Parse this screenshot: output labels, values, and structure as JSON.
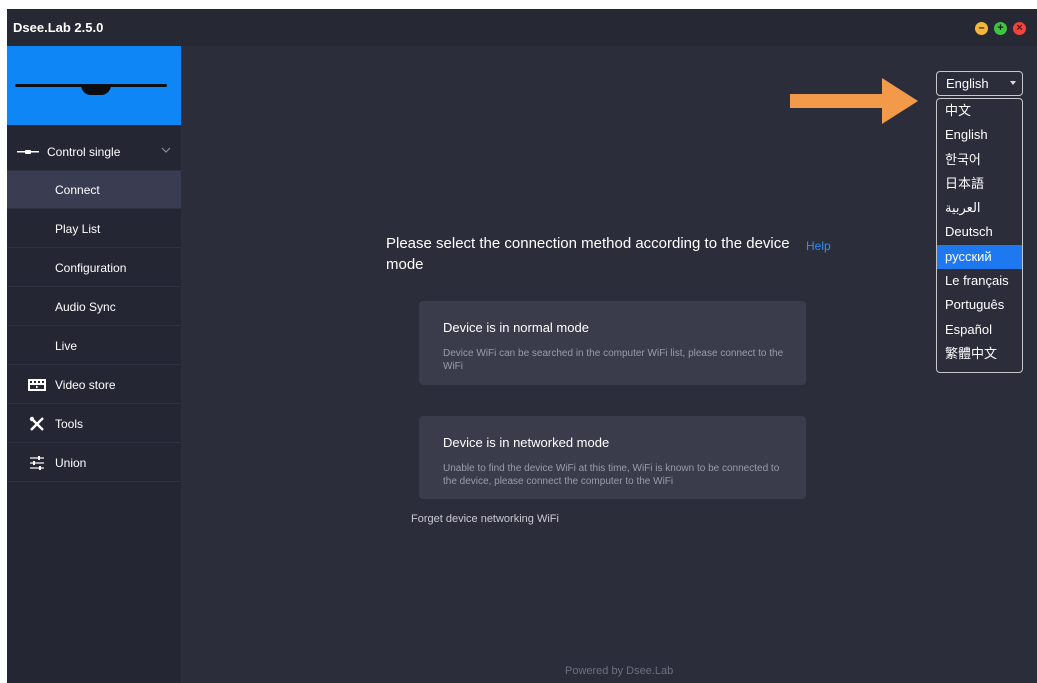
{
  "app": {
    "title": "Dsee.Lab 2.5.0"
  },
  "colors": {
    "accent": "#1e78f0",
    "link": "#2f8ef5",
    "arrow": "#f29a4a",
    "banner": "#0f86f5"
  },
  "sidebar": {
    "group": {
      "label": "Control single",
      "icon": "drone-icon"
    },
    "items": [
      {
        "label": "Connect",
        "active": true
      },
      {
        "label": "Play List"
      },
      {
        "label": "Configuration"
      },
      {
        "label": "Audio Sync"
      },
      {
        "label": "Live"
      }
    ],
    "sections": [
      {
        "label": "Video store",
        "icon": "film-icon"
      },
      {
        "label": "Tools",
        "icon": "tools-icon"
      },
      {
        "label": "Union",
        "icon": "sliders-icon"
      }
    ]
  },
  "main": {
    "heading": "Please select the connection method according to the device mode",
    "help": "Help",
    "cards": [
      {
        "title": "Device is in normal mode",
        "desc": "Device WiFi can be searched in the computer WiFi list, please connect to the WiFi"
      },
      {
        "title": "Device is in networked mode",
        "desc": "Unable to find the device WiFi at this time, WiFi is known to be connected to the device, please connect the computer to the WiFi"
      }
    ],
    "forget": "Forget device networking WiFi",
    "footer": "Powered by Dsee.Lab"
  },
  "language": {
    "selected": "English",
    "highlighted": "русский",
    "options": [
      "中文",
      "English",
      "한국어",
      "日本語",
      "العربية",
      "Deutsch",
      "русский",
      "Le français",
      "Português",
      "Español",
      "繁體中文"
    ]
  }
}
